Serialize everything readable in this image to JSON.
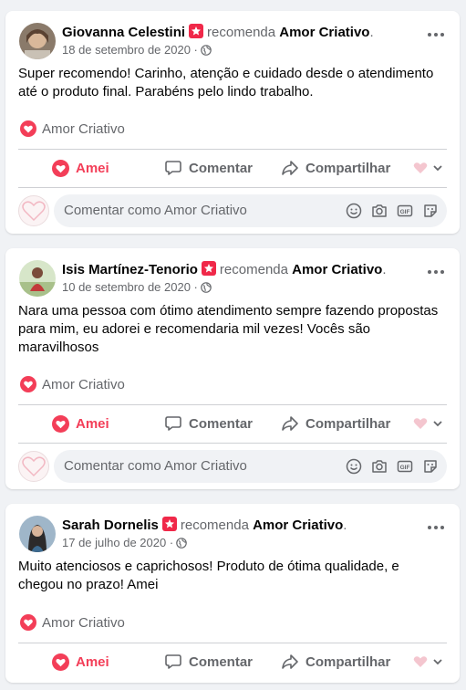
{
  "page_name": "Amor Criativo",
  "recommend_word": "recomenda",
  "actions": {
    "like": "Amei",
    "comment": "Comentar",
    "share": "Compartilhar"
  },
  "comment_placeholder": "Comentar como Amor Criativo",
  "colors": {
    "background": "#f0f2f5",
    "like_red": "#f33e58",
    "recommend_badge": "#f02849",
    "secondary_text": "#65676b"
  },
  "posts": [
    {
      "author": "Giovanna Celestini",
      "date": "18 de setembro de 2020",
      "text": "Super recomendo! Carinho, atenção e cuidado desde o atendimento até o produto final. Parabéns pelo lindo trabalho."
    },
    {
      "author": "Isis Martínez-Tenorio",
      "date": "10 de setembro de 2020",
      "text": "Nara uma pessoa com ótimo atendimento sempre fazendo propostas para mim, eu adorei e recomendaria mil vezes! Vocês são maravilhosos"
    },
    {
      "author": "Sarah Dornelis",
      "date": "17 de julho de 2020",
      "text": "Muito atenciosos e caprichosos! Produto de ótima qualidade, e chegou no prazo! Amei"
    }
  ],
  "icons": [
    "recommend-star-icon",
    "globe-icon",
    "more-options-icon",
    "heart-icon",
    "comment-icon",
    "share-icon",
    "reaction-selector-icon",
    "emoji-icon",
    "camera-icon",
    "gif-icon",
    "sticker-icon"
  ]
}
